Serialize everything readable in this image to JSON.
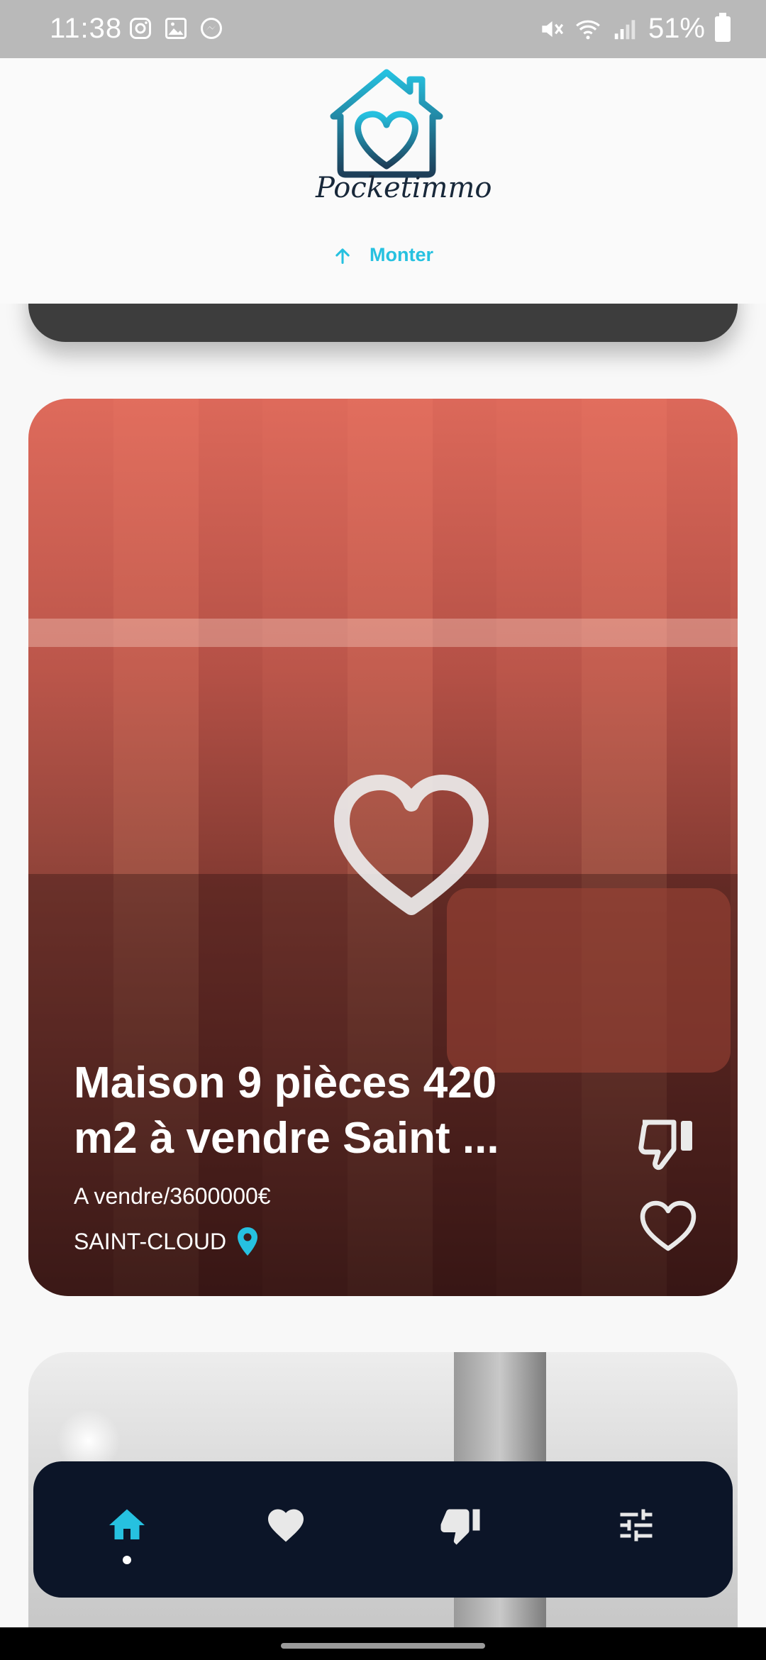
{
  "status_bar": {
    "time": "11:38",
    "left_icons": [
      "instagram-icon",
      "gallery-icon",
      "messenger-icon"
    ],
    "right_icons": [
      "mute-icon",
      "wifi-icon",
      "signal-icon"
    ],
    "battery": "51%"
  },
  "header": {
    "logo_text": "Pocketimmo",
    "scroll_up_label": "Monter"
  },
  "listing": {
    "title_line1": "Maison 9 pièces 420",
    "title_line2": "m2 à vendre Saint ...",
    "price_text": "A vendre/3600000€",
    "location": "SAINT-CLOUD",
    "center_icon": "heart-outline-icon",
    "actions": {
      "dislike_icon": "thumb-down-outline-icon",
      "like_icon": "heart-outline-icon"
    }
  },
  "bottom_nav": {
    "items": [
      {
        "name": "home",
        "icon": "home-icon",
        "active": true
      },
      {
        "name": "favorites",
        "icon": "heart-icon",
        "active": false
      },
      {
        "name": "dislikes",
        "icon": "thumb-down-icon",
        "active": false
      },
      {
        "name": "filters",
        "icon": "sliders-icon",
        "active": false
      }
    ]
  },
  "colors": {
    "accent": "#26c1e0",
    "nav_background": "#0c1528",
    "logo_dark": "#18283a"
  }
}
